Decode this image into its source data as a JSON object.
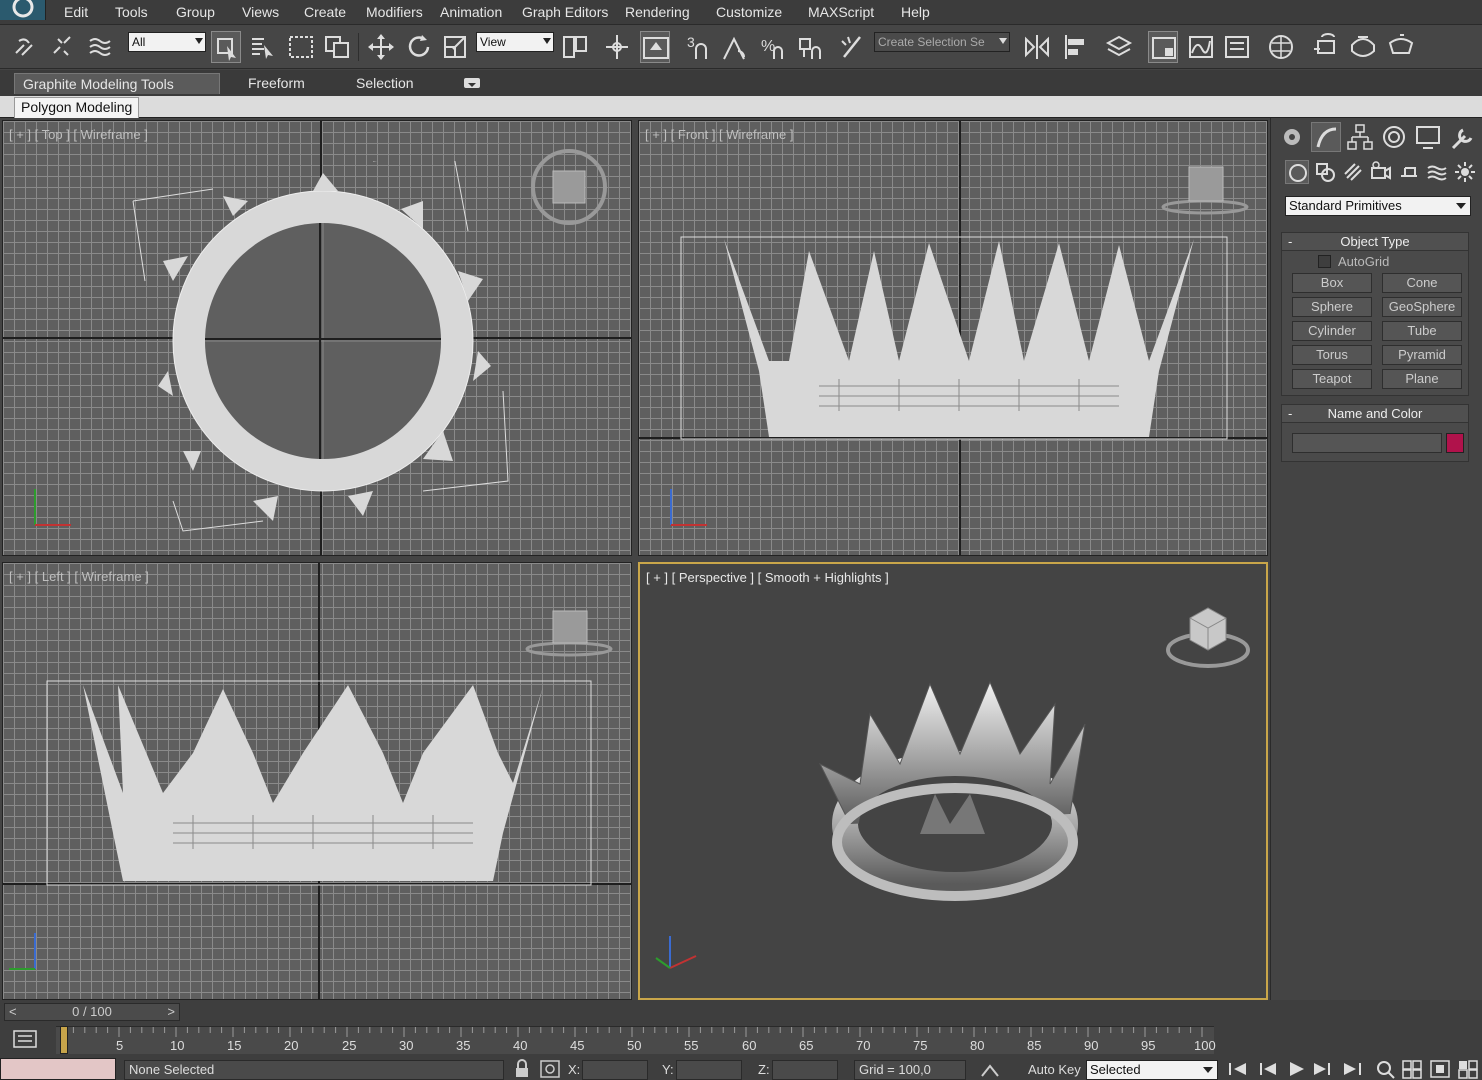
{
  "menubar": {
    "items": [
      "Edit",
      "Tools",
      "Group",
      "Views",
      "Create",
      "Modifiers",
      "Animation",
      "Graph Editors",
      "Rendering",
      "Customize",
      "MAXScript",
      "Help"
    ]
  },
  "toolbar": {
    "selection_filter": "All",
    "reference_coord": "View",
    "named_selection_placeholder": "Create Selection Se",
    "snap_label": "3",
    "icons": [
      "select-and-link-icon",
      "unlink-icon",
      "bind-to-spacewarp-icon",
      "select-object-icon",
      "select-by-name-icon",
      "rectangular-selection-icon",
      "window-crossing-icon",
      "select-and-move-icon",
      "select-and-rotate-icon",
      "select-and-scale-icon",
      "pivot-center-icon",
      "manipulate-icon",
      "keyboard-shortcut-icon",
      "snaps-toggle-icon",
      "angle-snap-icon",
      "percent-snap-icon",
      "spinner-snap-icon",
      "edit-named-selections-icon",
      "mirror-icon",
      "align-icon",
      "layer-manager-icon",
      "graphite-toggle-icon",
      "curve-editor-icon",
      "schematic-view-icon",
      "material-editor-icon",
      "render-setup-icon",
      "rendered-frame-icon",
      "render-icon"
    ]
  },
  "ribbon": {
    "tabs": [
      "Graphite Modeling Tools",
      "Freeform",
      "Selection"
    ],
    "sub_tab": "Polygon Modeling"
  },
  "viewports": {
    "top": {
      "label": "[ + ] [ Top ] [ Wireframe ]"
    },
    "front": {
      "label": "[ + ] [ Front ] [ Wireframe ]"
    },
    "left": {
      "label": "[ + ] [ Left ] [ Wireframe ]"
    },
    "perspective": {
      "label": "[ + ] [ Perspective ] [ Smooth + Highlights ]"
    }
  },
  "command_panel": {
    "tabs": [
      "create-tab-icon",
      "modify-tab-icon",
      "hierarchy-tab-icon",
      "motion-tab-icon",
      "display-tab-icon",
      "utilities-tab-icon"
    ],
    "category": "Standard Primitives",
    "object_type": {
      "title": "Object Type",
      "autogrid": "AutoGrid",
      "buttons": [
        "Box",
        "Cone",
        "Sphere",
        "GeoSphere",
        "Cylinder",
        "Tube",
        "Torus",
        "Pyramid",
        "Teapot",
        "Plane"
      ]
    },
    "name_and_color": {
      "title": "Name and Color",
      "color": "#b0124b"
    }
  },
  "bottom": {
    "time_slider": "0 / 100",
    "prev": "<",
    "next": ">",
    "ticks": [
      "0",
      "5",
      "10",
      "15",
      "20",
      "25",
      "30",
      "35",
      "40",
      "45",
      "50",
      "55",
      "60",
      "65",
      "70",
      "75",
      "80",
      "85",
      "90",
      "95",
      "100"
    ],
    "status": "None Selected",
    "x_label": "X:",
    "y_label": "Y:",
    "z_label": "Z:",
    "grid": "Grid = 100,0",
    "auto_key": "Auto Key",
    "key_filter": "Selected"
  }
}
